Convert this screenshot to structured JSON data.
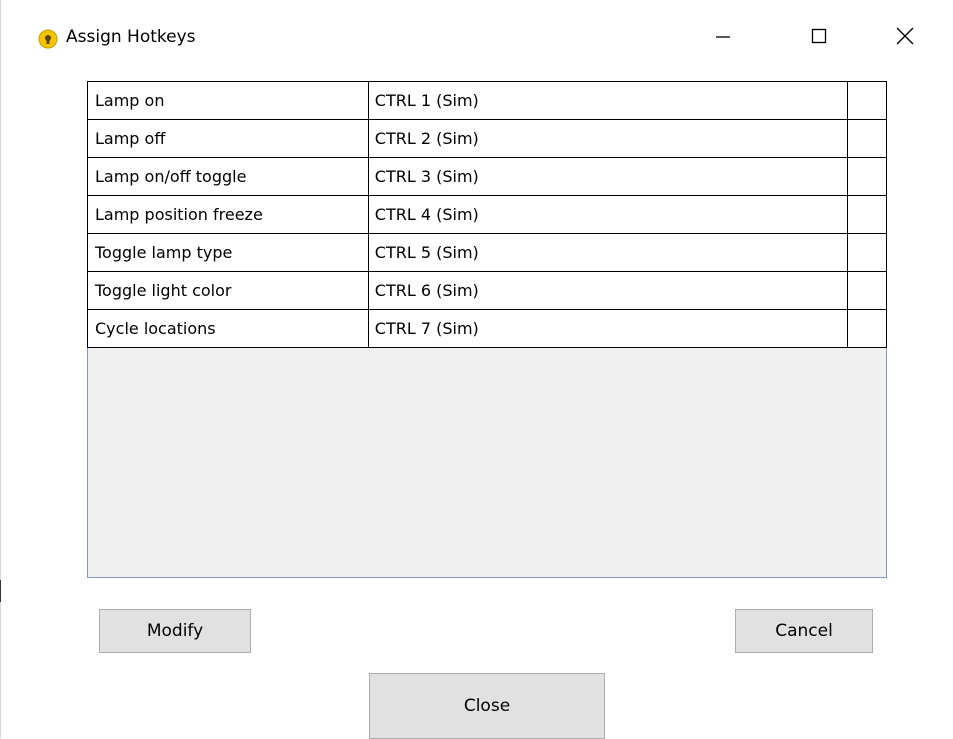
{
  "window": {
    "title": "Assign Hotkeys",
    "icon": "lightbulb-icon",
    "controls": [
      "minimize-icon",
      "maximize-icon",
      "close-icon"
    ]
  },
  "hotkeys": {
    "rows": [
      {
        "action": "Lamp on",
        "key": "CTRL 1 (Sim)",
        "extra": ""
      },
      {
        "action": "Lamp off",
        "key": "CTRL 2 (Sim)",
        "extra": ""
      },
      {
        "action": "Lamp on/off toggle",
        "key": "CTRL 3 (Sim)",
        "extra": ""
      },
      {
        "action": "Lamp position freeze",
        "key": "CTRL 4 (Sim)",
        "extra": ""
      },
      {
        "action": "Toggle lamp type",
        "key": "CTRL 5 (Sim)",
        "extra": ""
      },
      {
        "action": "Toggle light color",
        "key": "CTRL 6 (Sim)",
        "extra": ""
      },
      {
        "action": "Cycle locations",
        "key": "CTRL 7 (Sim)",
        "extra": ""
      }
    ]
  },
  "buttons": {
    "modify_label": "Modify",
    "cancel_label": "Cancel",
    "close_label": "Close"
  },
  "colors": {
    "grid_border": "#7a9cc6",
    "grid_empty_bg": "#f0f0f0",
    "button_bg": "#e1e1e1",
    "icon_yellow": "#f5c400"
  }
}
